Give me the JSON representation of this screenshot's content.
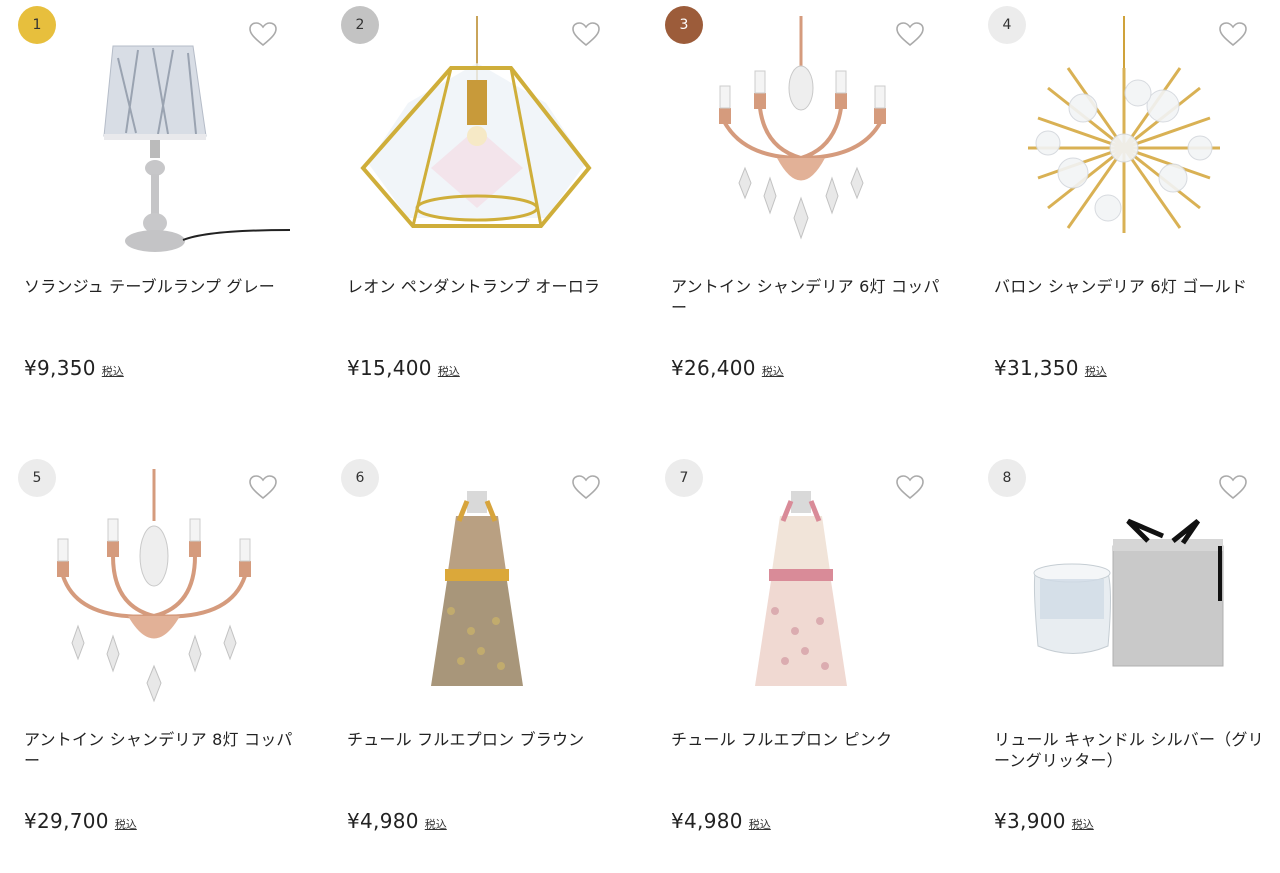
{
  "products": [
    {
      "rank": "1",
      "name": "ソランジュ テーブルランプ グレー",
      "price": "¥9,350",
      "tax": "税込",
      "icon": "table-lamp"
    },
    {
      "rank": "2",
      "name": "レオン ペンダントランプ オーロラ",
      "price": "¥15,400",
      "tax": "税込",
      "icon": "pendant-lamp"
    },
    {
      "rank": "3",
      "name": "アントイン シャンデリア 6灯 コッパー",
      "price": "¥26,400",
      "tax": "税込",
      "icon": "chandelier"
    },
    {
      "rank": "4",
      "name": "バロン シャンデリア 6灯 ゴールド",
      "price": "¥31,350",
      "tax": "税込",
      "icon": "sputnik-chandelier"
    },
    {
      "rank": "5",
      "name": "アントイン シャンデリア 8灯 コッパー",
      "price": "¥29,700",
      "tax": "税込",
      "icon": "chandelier"
    },
    {
      "rank": "6",
      "name": "チュール フルエプロン ブラウン",
      "price": "¥4,980",
      "tax": "税込",
      "icon": "apron"
    },
    {
      "rank": "7",
      "name": "チュール フルエプロン ピンク",
      "price": "¥4,980",
      "tax": "税込",
      "icon": "apron"
    },
    {
      "rank": "8",
      "name": "リュール キャンドル シルバー（グリーングリッター）",
      "price": "¥3,900",
      "tax": "税込",
      "icon": "candle-gift-box"
    }
  ],
  "colors": {
    "gold": "#e7bf3d",
    "silver": "#c3c3c3",
    "bronze": "#9c5c3a",
    "badge_default": "#ececec"
  }
}
